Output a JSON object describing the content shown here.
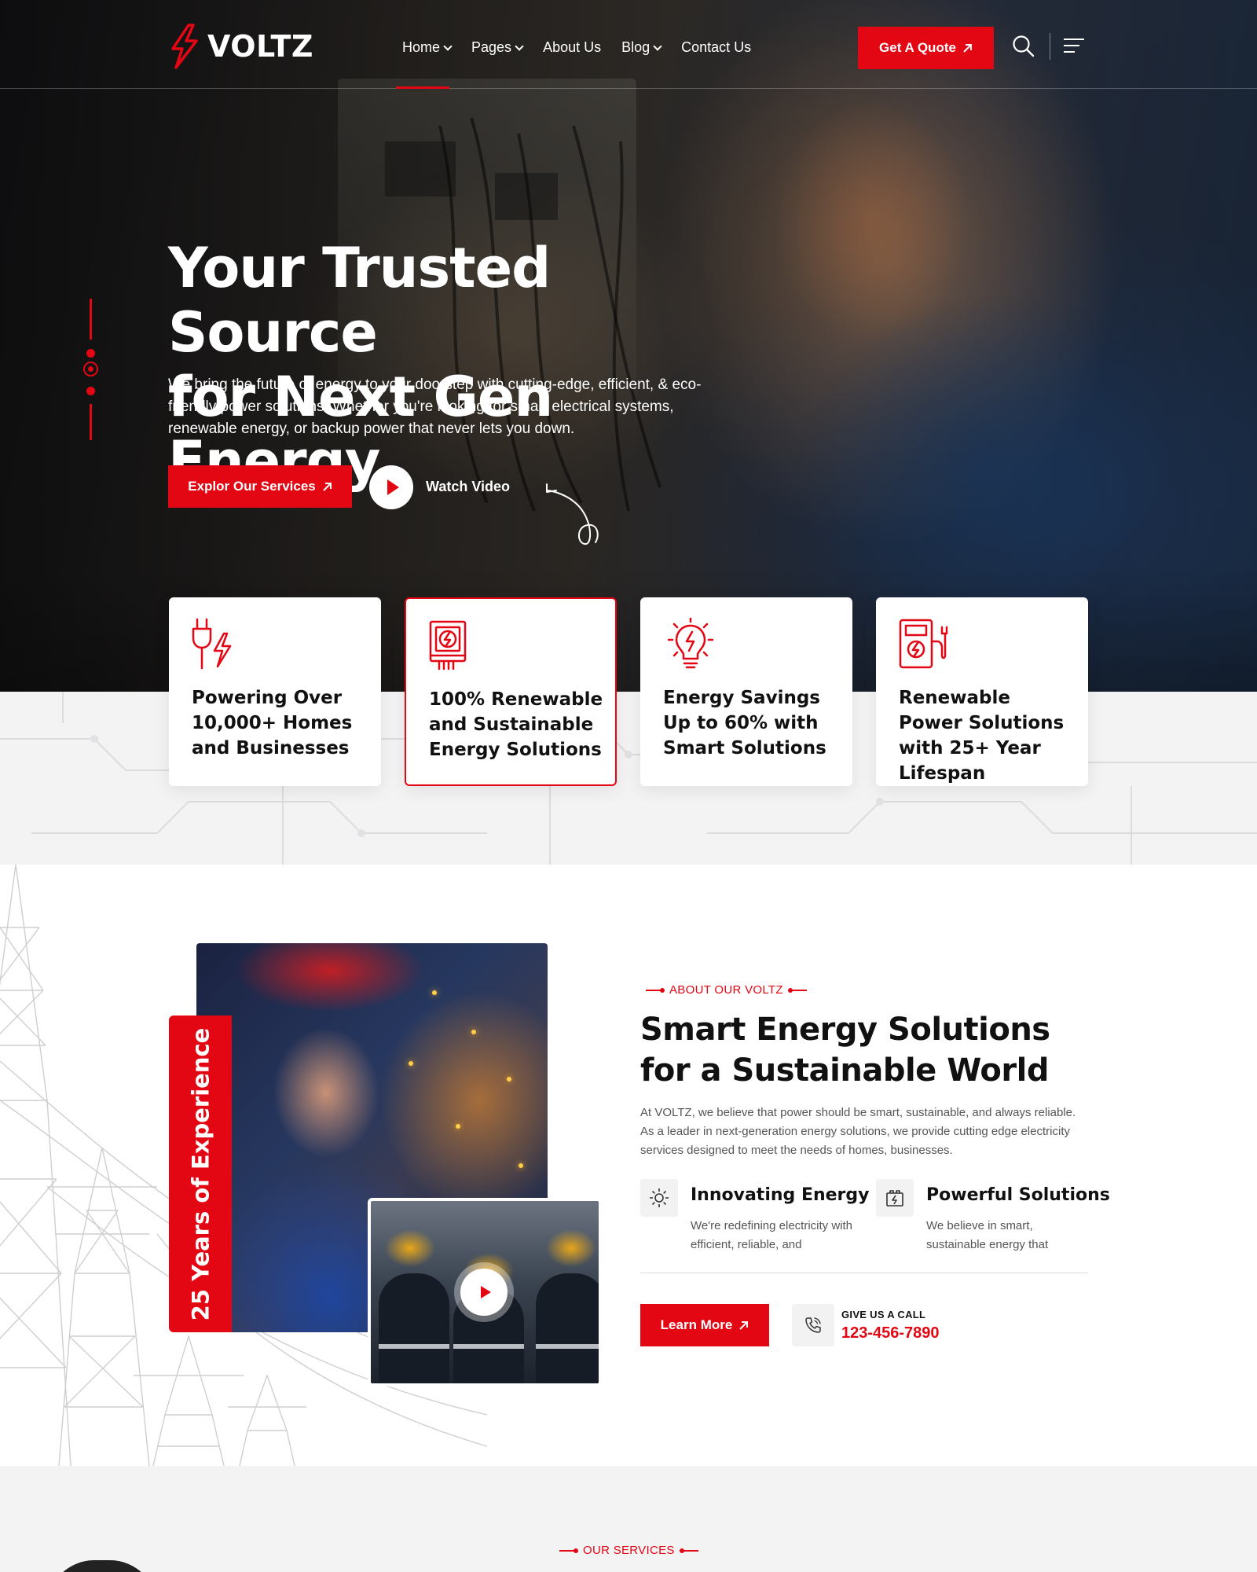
{
  "header": {
    "logo_text": "VOLTZ",
    "nav": [
      {
        "label": "Home",
        "dropdown": true,
        "active": true
      },
      {
        "label": "Pages",
        "dropdown": true
      },
      {
        "label": "About Us",
        "dropdown": false
      },
      {
        "label": "Blog",
        "dropdown": true
      },
      {
        "label": "Contact Us",
        "dropdown": false
      }
    ],
    "quote_button": "Get A Quote"
  },
  "hero": {
    "title_line1": "Your Trusted Source",
    "title_line2": "for Next Gen Energy",
    "description": "We bring the future of energy to your doorstep with cutting-edge, efficient, & eco-friendly power solutions. Whether you're looking for smart electrical systems, renewable energy, or backup power that never lets you down.",
    "primary_button": "Explor Our Services",
    "video_label": "Watch Video"
  },
  "features": [
    {
      "icon": "plug-bolt-icon",
      "text": "Powering Over 10,000+ Homes and Businesses"
    },
    {
      "icon": "energy-meter-icon",
      "text": "100% Renewable and Sustainable Energy Solutions",
      "active": true
    },
    {
      "icon": "lightbulb-bolt-icon",
      "text": "Energy Savings Up to 60% with Smart Solutions"
    },
    {
      "icon": "charging-station-icon",
      "text": "Renewable Power Solutions with 25+ Year Lifespan"
    }
  ],
  "about": {
    "experience_badge": "25 Years of Experience",
    "eyebrow": "ABOUT OUR VOLTZ",
    "title_line1": "Smart Energy Solutions",
    "title_line2": "for a Sustainable World",
    "description": "At VOLTZ, we believe that power should be smart, sustainable, and always reliable. As a leader in next-generation energy solutions, we provide cutting edge electricity services designed to meet the needs of homes, businesses.",
    "features": [
      {
        "icon": "innovation-gear-icon",
        "title": "Innovating Energy",
        "desc": "We're redefining electricity with efficient, reliable, and"
      },
      {
        "icon": "battery-panel-icon",
        "title": "Powerful Solutions",
        "desc": "We believe in smart, sustainable energy that"
      }
    ],
    "learn_button": "Learn More",
    "call_label": "GIVE US A CALL",
    "call_number": "123-456-7890"
  },
  "services": {
    "eyebrow": "OUR SERVICES"
  },
  "colors": {
    "accent": "#e30613",
    "dark_text": "#111111",
    "light_bg": "#f3f3f4"
  }
}
